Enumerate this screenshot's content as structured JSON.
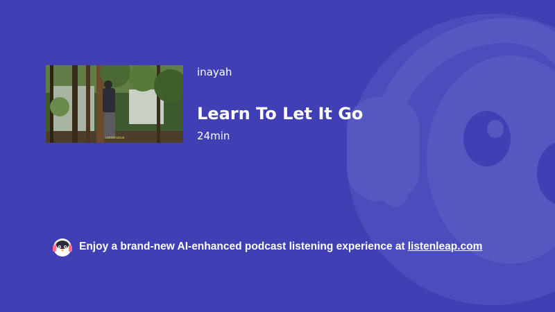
{
  "colors": {
    "background": "#4040b4",
    "mascot_overlay": "#5658c2",
    "text": "#ffffff"
  },
  "episode": {
    "author": "inayah",
    "title": "Learn To Let It Go",
    "duration": "24min",
    "thumbnail_icon": "forest-person-thumbnail"
  },
  "promo": {
    "logo_icon": "penguin-headphones-icon",
    "text": "Enjoy a brand-new AI-enhanced podcast listening experience at",
    "link_text": "listenleap.com"
  }
}
